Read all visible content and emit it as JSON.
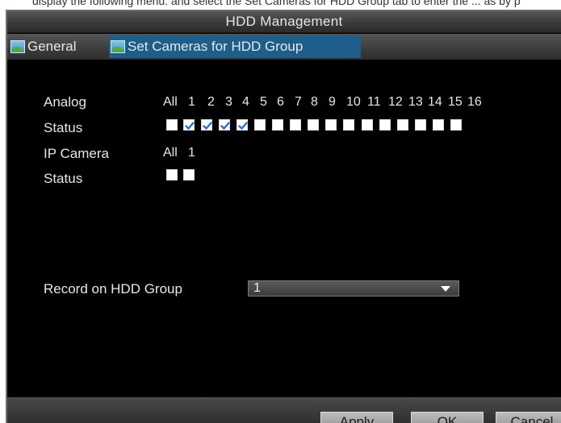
{
  "top_text": "display the following menu: and select the Set Cameras for HDD Group tab to enter the ... as by p",
  "window": {
    "title": "HDD Management"
  },
  "tabs": [
    {
      "label": "General",
      "icon": "landscape-icon",
      "active": false
    },
    {
      "label": "Set Cameras for HDD Group",
      "icon": "landscape-icon",
      "active": true
    }
  ],
  "analog": {
    "label": "Analog",
    "status_label": "Status",
    "all_label": "All",
    "channels": [
      "1",
      "2",
      "3",
      "4",
      "5",
      "6",
      "7",
      "8",
      "9",
      "10",
      "11",
      "12",
      "13",
      "14",
      "15",
      "16"
    ],
    "checked": [
      false,
      true,
      true,
      true,
      true,
      false,
      false,
      false,
      false,
      false,
      false,
      false,
      false,
      false,
      false,
      false,
      false
    ]
  },
  "ip_camera": {
    "label": "IP Camera",
    "status_label": "Status",
    "all_label": "All",
    "channels": [
      "1"
    ],
    "checked": [
      false,
      false
    ]
  },
  "record_group": {
    "label": "Record on HDD Group",
    "value": "1"
  },
  "buttons": {
    "apply": "Apply",
    "ok": "OK",
    "cancel": "Cancel"
  }
}
